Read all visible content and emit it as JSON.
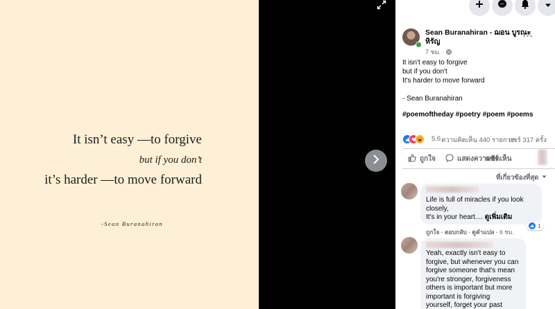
{
  "photo": {
    "line1": "It isn’t easy —to forgive",
    "line2": "but if you don’t",
    "line3": "it’s harder —to move forward",
    "signature": "-Sean Buranahiran"
  },
  "post": {
    "author": "Sean Buranahiran - ฌอน บูรณะหิรัญ",
    "time": "7 ชม.",
    "privacy_separator": "·",
    "body_lines": [
      "It isn't easy to forgive",
      "but if you don't",
      "It's harder to move forward",
      "",
      "- Sean Buranahiran"
    ],
    "hashtags": "#poemoftheday #poetry #poem #poems",
    "reaction_count": "5.6",
    "comments_count": "ความคิดเห็น 440 รายการ",
    "shares": "แชร์ 317 ครั้ง",
    "like_label": "ถูกใจ",
    "comment_label": "แสดงความคิดเห็น",
    "share_label": "แชร์",
    "filter_label": "ที่เกี่ยวข้องที่สุด"
  },
  "comments": [
    {
      "text_lines": [
        "Life is full of miracles if you look",
        "closely,",
        "It's in your heart.... "
      ],
      "see_more": "ดูเพิ่มเติม",
      "like": "ถูกใจ",
      "reply": "ตอบกลับ",
      "translate": "ดูคำแปล",
      "time": "6 ชม.",
      "likes": "1"
    },
    {
      "text_lines": [
        "Yeah, exactly isn't easy to",
        "forgive, but whenever you can",
        "forgive someone that's mean",
        "you're stronger, forgiveness",
        "others is important but more",
        "important is forgiving",
        "yourself, forget your past"
      ]
    }
  ],
  "icons": {
    "expand": "expand-icon",
    "next": "chevron-right-icon",
    "plus": "plus-icon",
    "messenger": "messenger-icon",
    "notifications": "bell-icon",
    "account": "caret-down-icon"
  }
}
